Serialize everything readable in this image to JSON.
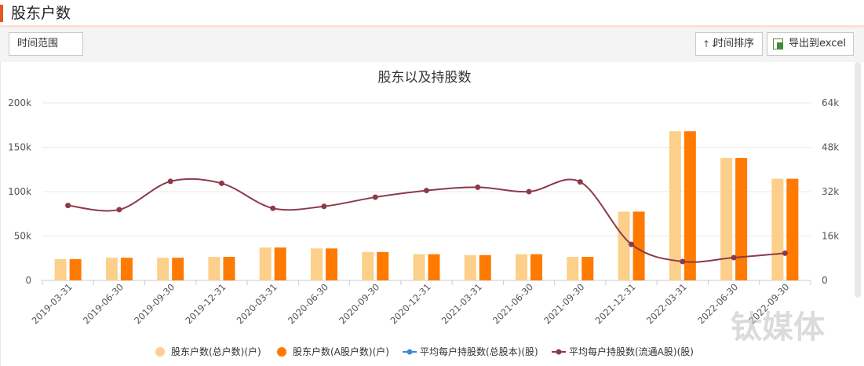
{
  "header": {
    "title": "股东户数"
  },
  "toolbar": {
    "range_label": "时间范围",
    "sort_label": "时间排序",
    "sort_icon": "↑↓",
    "export_label": "导出到excel"
  },
  "watermark": {
    "text": "钛媒体"
  },
  "chart_data": {
    "type": "bar",
    "title": "股东以及持股数",
    "categories": [
      "2019-03-31",
      "2019-06-30",
      "2019-09-30",
      "2019-12-31",
      "2020-03-31",
      "2020-06-30",
      "2020-09-30",
      "2020-12-31",
      "2021-03-31",
      "2021-06-30",
      "2021-09-30",
      "2021-12-31",
      "2022-03-31",
      "2022-06-30",
      "2022-09-30"
    ],
    "ylim_left": [
      0,
      200000
    ],
    "ylim_right": [
      0,
      64000
    ],
    "yticks_left": [
      "0",
      "50k",
      "100k",
      "150k",
      "200k"
    ],
    "yticks_right": [
      "0",
      "16k",
      "32k",
      "48k",
      "64k"
    ],
    "series": [
      {
        "name": "股东户数(总户数)(户)",
        "type": "bar",
        "axis": "left",
        "color": "#fcd08a",
        "values": [
          24000,
          25500,
          25500,
          26500,
          37000,
          36000,
          32000,
          29500,
          28500,
          29500,
          26500,
          77500,
          168000,
          138000,
          114500
        ]
      },
      {
        "name": "股东户数(A股户数)(户)",
        "type": "bar",
        "axis": "left",
        "color": "#ff7a00",
        "values": [
          24000,
          25500,
          25500,
          26500,
          37000,
          36000,
          32000,
          29500,
          28500,
          29500,
          26500,
          77500,
          168000,
          138000,
          114500
        ]
      },
      {
        "name": "平均每户持股数(总股本)(股)",
        "type": "line",
        "axis": "right",
        "color": "#3c88d6",
        "values": []
      },
      {
        "name": "平均每户持股数(流通A股)(股)",
        "type": "line",
        "axis": "right",
        "color": "#8c3a4a",
        "values": [
          27000,
          25500,
          35700,
          35000,
          26000,
          26700,
          30000,
          32400,
          33600,
          32000,
          35500,
          13000,
          6800,
          8200,
          9800
        ]
      }
    ],
    "grid": true,
    "legend": "bottom"
  }
}
